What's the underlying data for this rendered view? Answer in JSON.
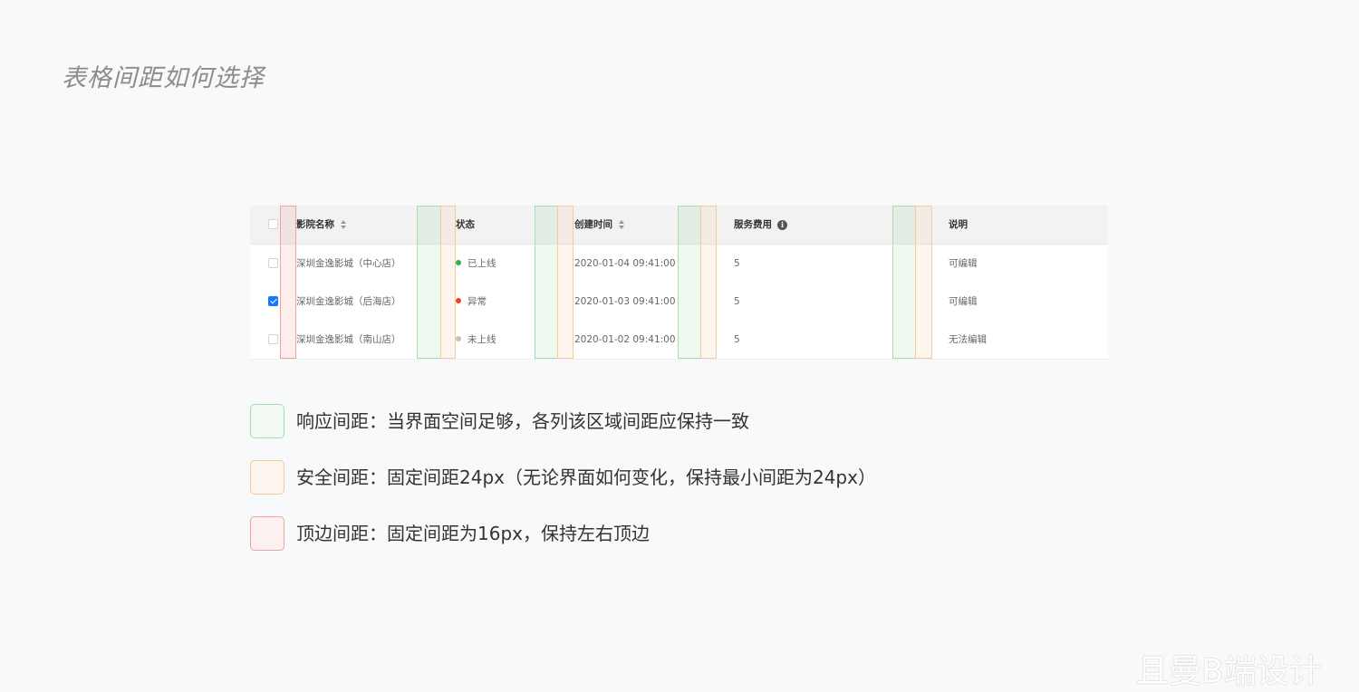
{
  "page_title": "表格间距如何选择",
  "table": {
    "headers": {
      "name": "影院名称",
      "status": "状态",
      "created": "创建时间",
      "fee": "服务费用",
      "note": "说明"
    },
    "rows": [
      {
        "checked": false,
        "name": "深圳金逸影城（中心店）",
        "status": "已上线",
        "status_color": "#2bb24c",
        "created": "2020-01-04  09:41:00",
        "fee": "5",
        "note": "可编辑"
      },
      {
        "checked": true,
        "name": "深圳金逸影城（后海店）",
        "status": "异常",
        "status_color": "#e8412c",
        "created": "2020-01-03  09:41:00",
        "fee": "5",
        "note": "可编辑"
      },
      {
        "checked": false,
        "name": "深圳金逸影城（南山店）",
        "status": "未上线",
        "status_color": "#c2c2c2",
        "created": "2020-01-02  09:41:00",
        "fee": "5",
        "note": "无法编辑"
      }
    ]
  },
  "legend": [
    {
      "type": "green",
      "text": "响应间距：当界面空间足够，各列该区域间距应保持一致"
    },
    {
      "type": "orange",
      "text": "安全间距：固定间距24px（无论界面如何变化，保持最小间距为24px）"
    },
    {
      "type": "red",
      "text": "顶边间距：固定间距为16px，保持左右顶边"
    }
  ],
  "colors": {
    "responsive": "#a8dcae",
    "safe": "#f6c99a",
    "edge": "#f0a39f",
    "checkbox_checked": "#1677ff"
  },
  "watermark": "且曼B端设计"
}
